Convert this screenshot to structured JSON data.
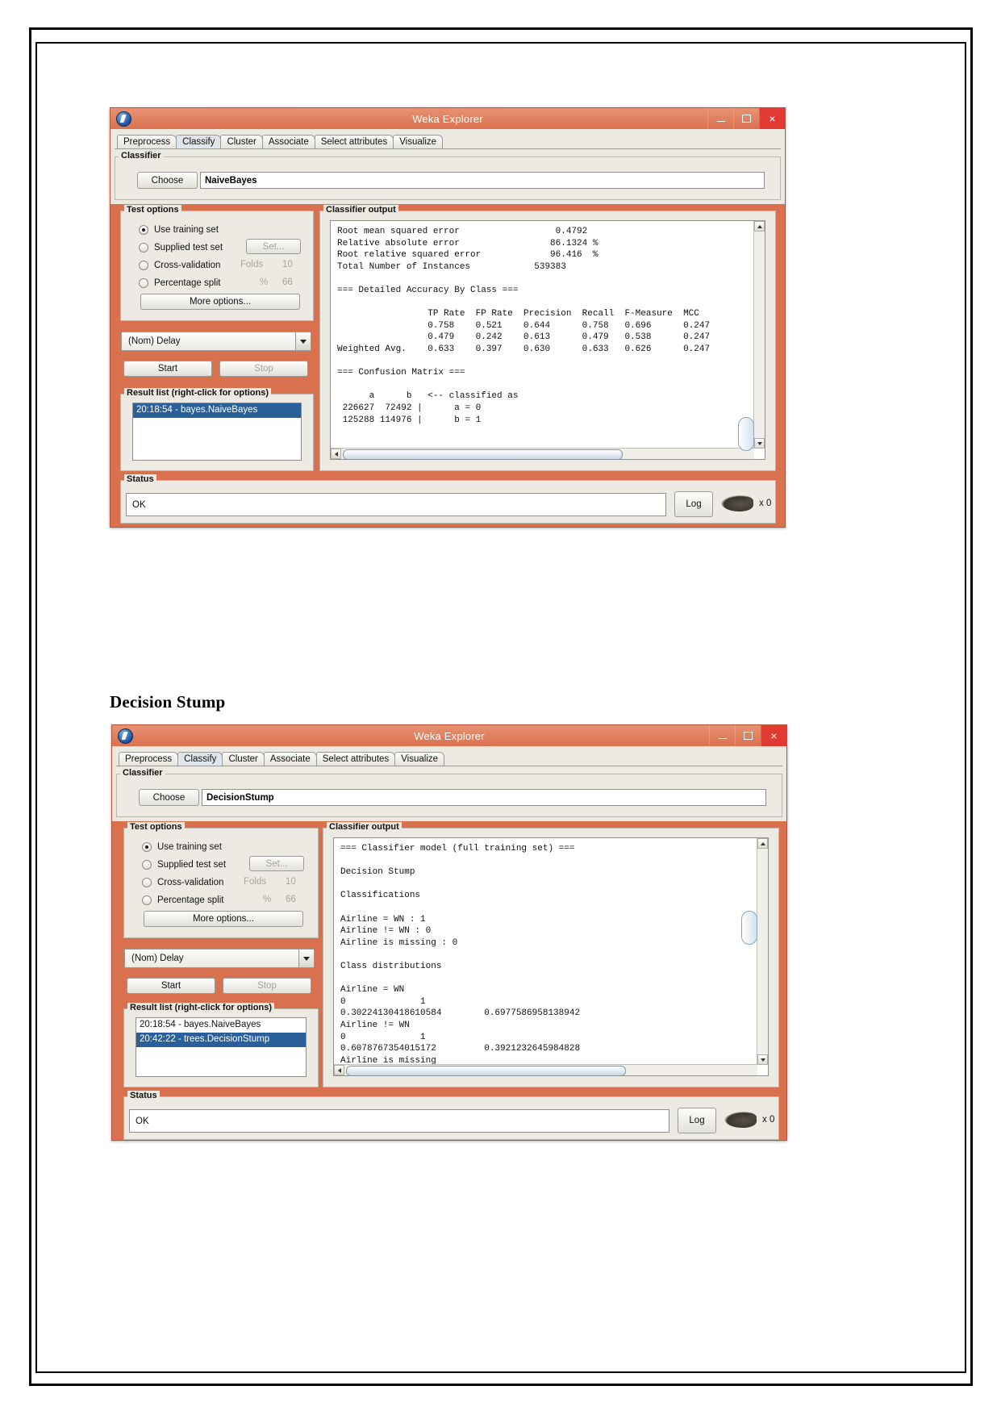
{
  "document": {
    "section_heading": "Decision Stump"
  },
  "windows": [
    {
      "id": "naivebayes",
      "title": "Weka Explorer",
      "logo_icon": "weka-bird-logo-icon",
      "controls": {
        "minimize": "minimize-icon",
        "maximize": "maximize-icon",
        "close": "×"
      },
      "tabs": [
        {
          "label": "Preprocess",
          "active": false
        },
        {
          "label": "Classify",
          "active": true
        },
        {
          "label": "Cluster",
          "active": false
        },
        {
          "label": "Associate",
          "active": false
        },
        {
          "label": "Select attributes",
          "active": false
        },
        {
          "label": "Visualize",
          "active": false
        }
      ],
      "classifier": {
        "group_title": "Classifier",
        "choose_label": "Choose",
        "value": "NaiveBayes"
      },
      "test_options": {
        "group_title": "Test options",
        "options": [
          {
            "label": "Use training set",
            "checked": true
          },
          {
            "label": "Supplied test set",
            "checked": false
          },
          {
            "label": "Cross-validation",
            "checked": false
          },
          {
            "label": "Percentage split",
            "checked": false
          }
        ],
        "set_button": "Set...",
        "folds_label": "Folds",
        "folds_value": "10",
        "percent_label": "%",
        "percent_value": "66",
        "more_options": "More options..."
      },
      "class_combo": "(Nom) Delay",
      "start_button": "Start",
      "stop_button": "Stop",
      "result_list": {
        "title": "Result list (right-click for options)",
        "items": [
          {
            "label": "20:18:54 - bayes.NaiveBayes",
            "selected": true
          }
        ]
      },
      "classifier_output": {
        "title": "Classifier output",
        "text": "Root mean squared error                  0.4792\nRelative absolute error                 86.1324 %\nRoot relative squared error             96.416  %\nTotal Number of Instances            539383     \n\n=== Detailed Accuracy By Class ===\n\n                 TP Rate  FP Rate  Precision  Recall  F-Measure  MCC \n                 0.758    0.521    0.644      0.758   0.696      0.247\n                 0.479    0.242    0.613      0.479   0.538      0.247\nWeighted Avg.    0.633    0.397    0.630      0.633   0.626      0.247\n\n=== Confusion Matrix ===\n\n      a      b   <-- classified as\n 226627  72492 |      a = 0\n 125288 114976 |      b = 1"
      },
      "status": {
        "group_title": "Status",
        "text": "OK",
        "log_button": "Log",
        "bird_icon": "weka-bird-animation-icon",
        "task_count": "x 0"
      }
    },
    {
      "id": "decisionstump",
      "title": "Weka Explorer",
      "logo_icon": "weka-bird-logo-icon",
      "controls": {
        "minimize": "minimize-icon",
        "maximize": "maximize-icon",
        "close": "×"
      },
      "tabs": [
        {
          "label": "Preprocess",
          "active": false
        },
        {
          "label": "Classify",
          "active": true
        },
        {
          "label": "Cluster",
          "active": false
        },
        {
          "label": "Associate",
          "active": false
        },
        {
          "label": "Select attributes",
          "active": false
        },
        {
          "label": "Visualize",
          "active": false
        }
      ],
      "classifier": {
        "group_title": "Classifier",
        "choose_label": "Choose",
        "value": "DecisionStump"
      },
      "test_options": {
        "group_title": "Test options",
        "options": [
          {
            "label": "Use training set",
            "checked": true
          },
          {
            "label": "Supplied test set",
            "checked": false
          },
          {
            "label": "Cross-validation",
            "checked": false
          },
          {
            "label": "Percentage split",
            "checked": false
          }
        ],
        "set_button": "Set...",
        "folds_label": "Folds",
        "folds_value": "10",
        "percent_label": "%",
        "percent_value": "66",
        "more_options": "More options..."
      },
      "class_combo": "(Nom) Delay",
      "start_button": "Start",
      "stop_button": "Stop",
      "result_list": {
        "title": "Result list (right-click for options)",
        "items": [
          {
            "label": "20:18:54 - bayes.NaiveBayes",
            "selected": false
          },
          {
            "label": "20:42:22 - trees.DecisionStump",
            "selected": true
          }
        ]
      },
      "classifier_output": {
        "title": "Classifier output",
        "text": "=== Classifier model (full training set) ===\n\nDecision Stump\n\nClassifications\n\nAirline = WN : 1\nAirline != WN : 0\nAirline is missing : 0\n\nClass distributions\n\nAirline = WN\n0              1\n0.30224130418610584        0.6977586958138942\nAirline != WN\n0              1\n0.6078767354015172         0.3921232645984828\nAirline is missing"
      },
      "status": {
        "group_title": "Status",
        "text": "OK",
        "log_button": "Log",
        "bird_icon": "weka-bird-animation-icon",
        "task_count": "x 0"
      }
    }
  ]
}
